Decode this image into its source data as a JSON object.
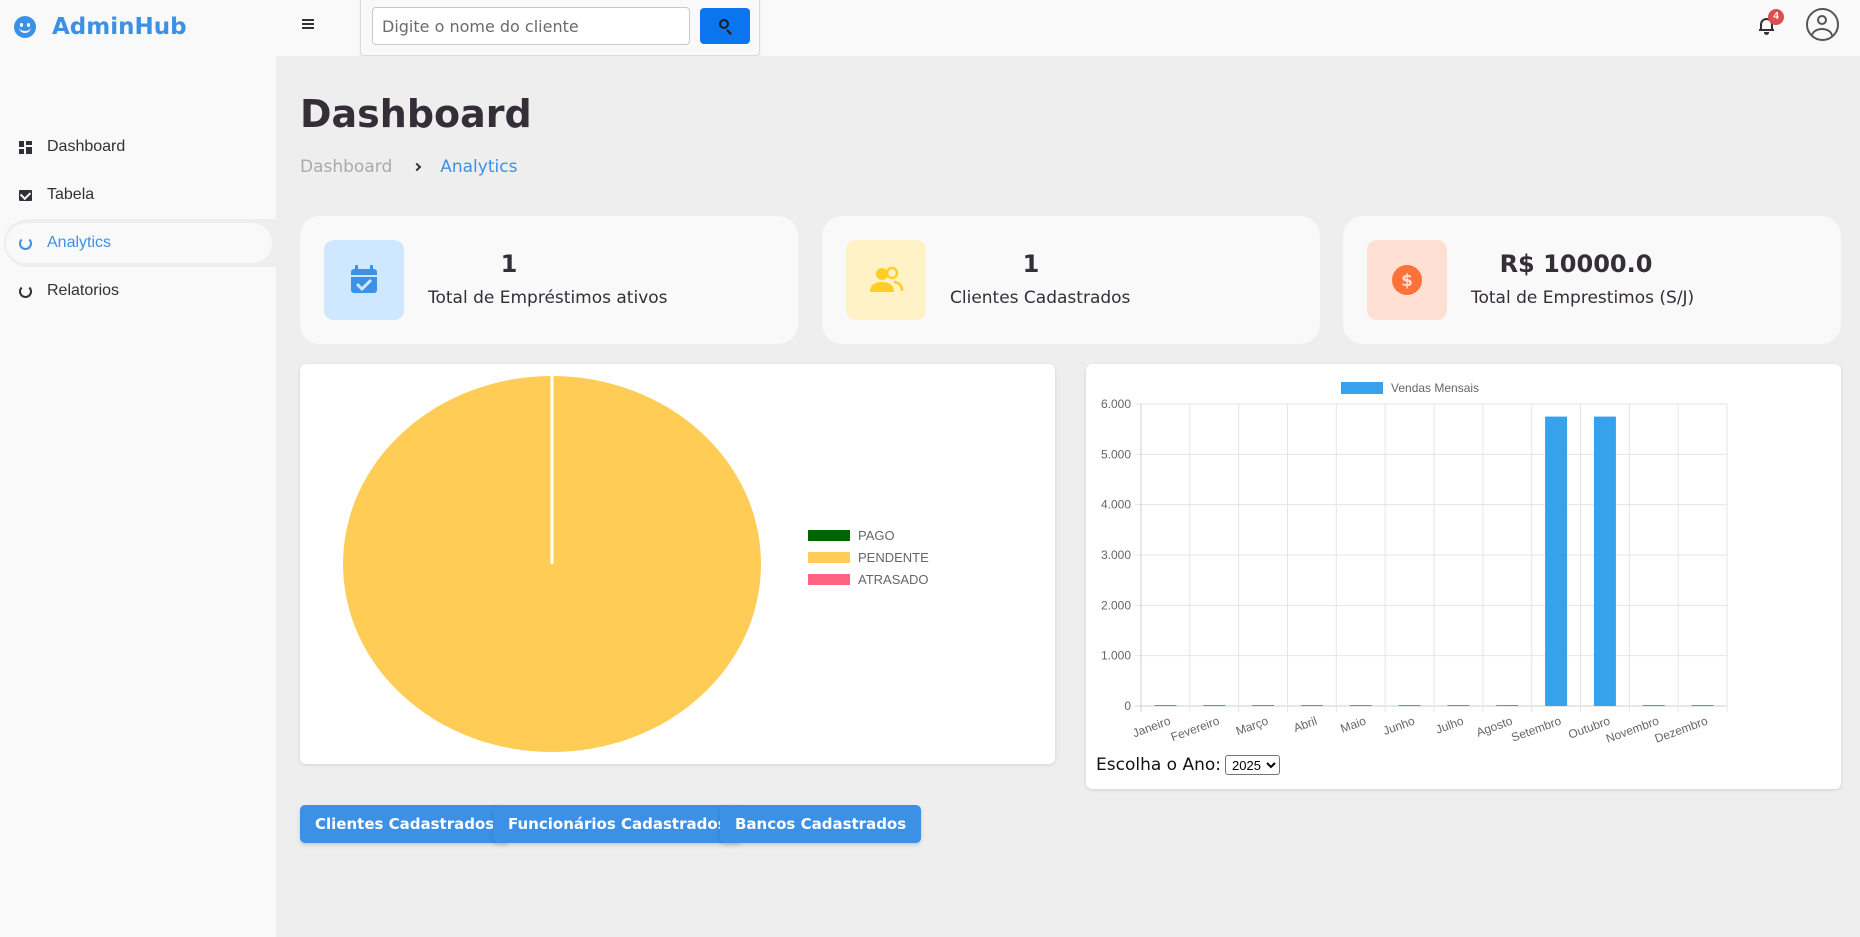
{
  "app": {
    "brand": "AdminHub"
  },
  "sidebar": {
    "items": [
      {
        "label": "Dashboard",
        "icon": "dashboard-icon"
      },
      {
        "label": "Tabela",
        "icon": "mail-icon"
      },
      {
        "label": "Analytics",
        "icon": "analytics-ring-icon",
        "active": true
      },
      {
        "label": "Relatorios",
        "icon": "report-ring-icon"
      }
    ]
  },
  "topbar": {
    "search_placeholder": "Digite o nome do cliente",
    "notification_count": "4"
  },
  "page": {
    "title": "Dashboard",
    "breadcrumb": [
      "Dashboard",
      "Analytics"
    ]
  },
  "cards": [
    {
      "value": "1",
      "label": "Total de Empréstimos ativos",
      "icon": "calendar-check-icon",
      "tile_color": "#cfe8ff",
      "icon_color": "#3c91e6"
    },
    {
      "value": "1",
      "label": "Clientes Cadastrados",
      "icon": "people-icon",
      "tile_color": "#fff2c6",
      "icon_color": "#ffce26"
    },
    {
      "value": "R$ 10000.0",
      "label": "Total de Emprestimos (S/J)",
      "icon": "dollar-circle-icon",
      "tile_color": "#ffe0d3",
      "icon_color": "#fd7238"
    }
  ],
  "chart_data": [
    {
      "type": "pie",
      "labels": [
        "PAGO",
        "PENDENTE",
        "ATRASADO"
      ],
      "values": [
        0,
        1,
        0
      ],
      "colors": [
        "#006400",
        "#ffcd56",
        "#ff6384"
      ],
      "legend_position": "right"
    },
    {
      "type": "bar",
      "series": [
        {
          "name": "Vendas Mensais",
          "values": [
            0,
            0,
            0,
            0,
            0,
            0,
            0,
            0,
            5750,
            5750,
            0,
            0
          ],
          "color": "#36a2eb"
        }
      ],
      "categories": [
        "Janeiro",
        "Fevereiro",
        "Março",
        "Abril",
        "Maio",
        "Junho",
        "Julho",
        "Agosto",
        "Setembro",
        "Outubro",
        "Novembro",
        "Dezembro"
      ],
      "ylim": [
        0,
        6000
      ],
      "yticks": [
        "0",
        "1.000",
        "2.000",
        "3.000",
        "4.000",
        "5.000",
        "6.000"
      ],
      "grid": true,
      "legend_position": "top"
    }
  ],
  "year_picker": {
    "label": "Escolha o Ano:",
    "selected": "2025"
  },
  "buttons": [
    "Clientes Cadastrados",
    "Funcionários Cadastrados",
    "Bancos Cadastrados"
  ]
}
